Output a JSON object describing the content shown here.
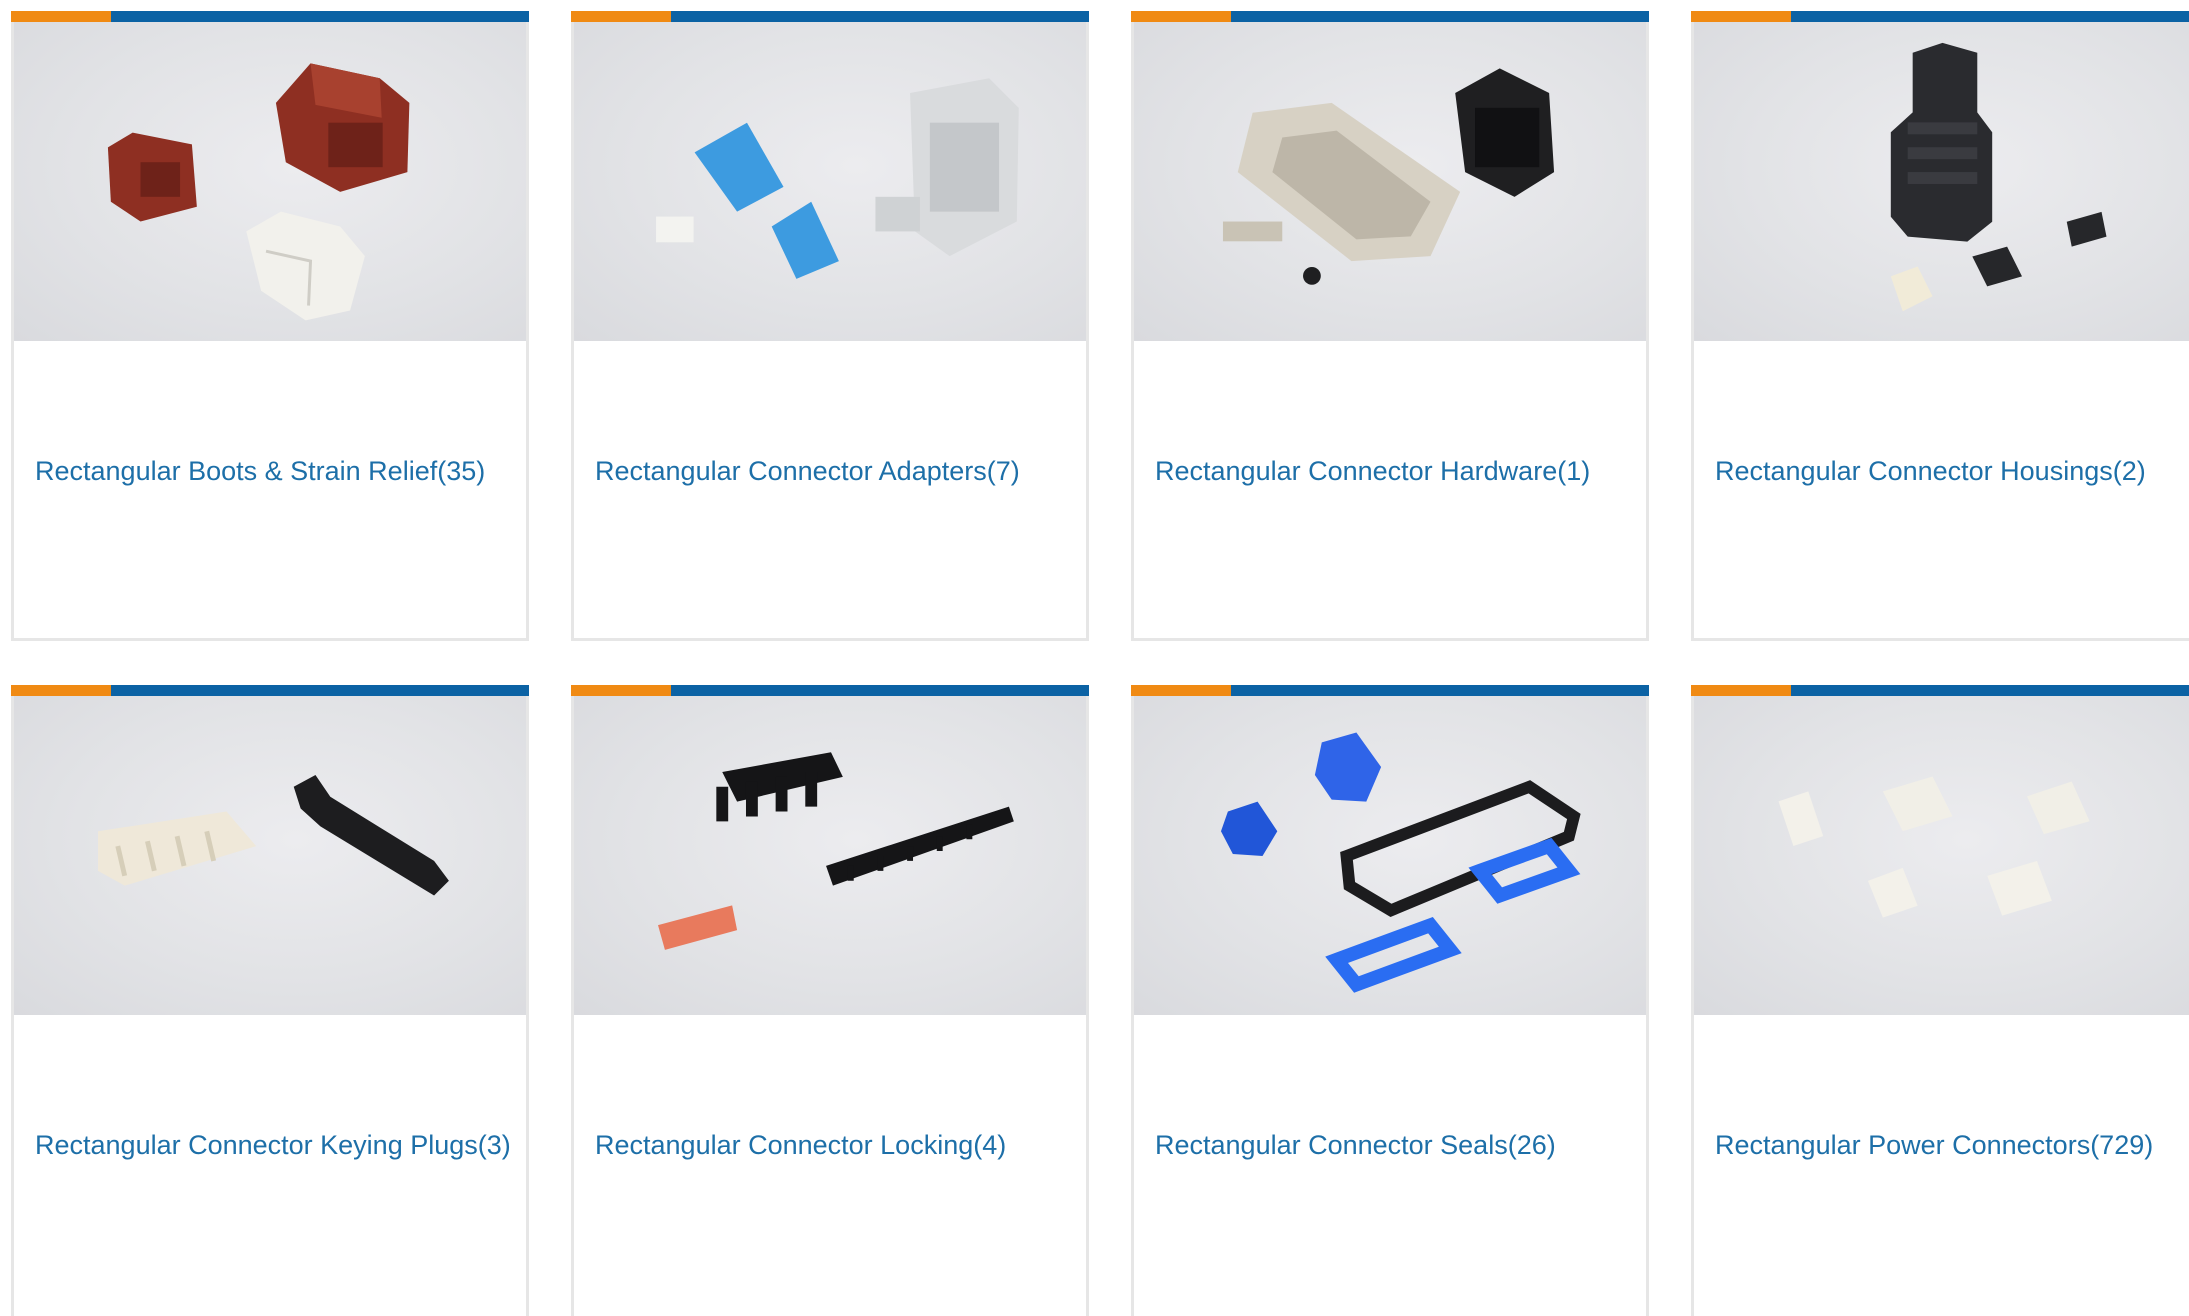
{
  "colors": {
    "accent_orange": "#f08a13",
    "accent_blue": "#0b62a4",
    "link_blue": "#1d6fa8",
    "card_border": "#e6e6e6"
  },
  "categories": [
    {
      "label": "Rectangular Boots & Strain Relief(35)",
      "image": "boots-strain-relief-product-photo"
    },
    {
      "label": "Rectangular Connector Adapters(7)",
      "image": "connector-adapters-product-photo"
    },
    {
      "label": "Rectangular Connector Hardware(1)",
      "image": "connector-hardware-product-photo"
    },
    {
      "label": "Rectangular Connector Housings(2)",
      "image": "connector-housings-product-photo"
    },
    {
      "label": "Rectangular Connector Keying Plugs(3)",
      "image": "keying-plugs-product-photo"
    },
    {
      "label": "Rectangular Connector Locking(4)",
      "image": "connector-locking-product-photo"
    },
    {
      "label": "Rectangular Connector Seals(26)",
      "image": "connector-seals-product-photo"
    },
    {
      "label": "Rectangular Power Connectors(729)",
      "image": "power-connectors-product-photo"
    }
  ]
}
